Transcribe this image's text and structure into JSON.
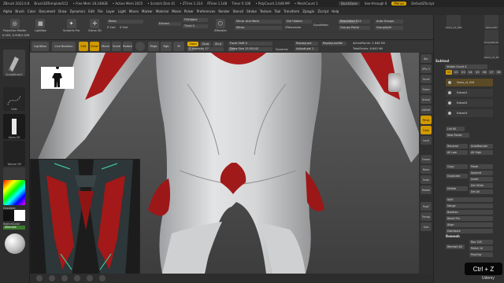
{
  "window": {
    "title_items": [
      "ZBrush 2022.0.8",
      "Brush3DTemplate512",
      "• Free Mem 18.248GB",
      "• Active Mem 2025",
      "• Scratch Disk 41",
      "• ZTime 1.314",
      "RTime 1.148",
      "Timer 0.106",
      "• PolyCount 2.648 MP",
      "• MeshCount 1"
    ],
    "quicksave": "QuickSave",
    "see_through": "See-through 0",
    "menus_label": "Menus",
    "default_script": "DefaultZScript"
  },
  "menubar": [
    "Alpha",
    "Brush",
    "Color",
    "Document",
    "Draw",
    "Dynamics",
    "Edit",
    "File",
    "Layer",
    "Light",
    "Macro",
    "Marker",
    "Material",
    "Movie",
    "Picker",
    "Preferences",
    "Render",
    "Stencil",
    "Stroke",
    "Texture",
    "Tool",
    "Transform",
    "Zplugin",
    "Zscript",
    "Help"
  ],
  "toolbar": {
    "coords": "0.003,-0.906,0.028",
    "buttons": [
      "Projection Master",
      "LightBox",
      "Sculptris Pro",
      "Gizmo 3D",
      "ZRemesher"
    ],
    "relax": "Relax",
    "extract": "Extract",
    "e_smt": "E Smt",
    "s_smt": "S Smt",
    "fill_object": "FillObject",
    "thick": "Thick 0",
    "zmodeler": "ZModeler",
    "mirror_weld": "Mirror And Weld",
    "del_hidden": "Del Hidden",
    "mirror": "Mirror",
    "zremesher": "ZRemesher",
    "dynamesh": "DynaMesh",
    "resolution": "Resolution 512",
    "auto_groups": "Auto Groups",
    "groups_polish": "Groups Polish",
    "group_split": "GroupSplit"
  },
  "toolbar2": {
    "lightbox": "LightBox",
    "live_boolean": "Live Boolean",
    "edit": "Edit",
    "draw": "Draw",
    "move": "Move",
    "scale": "Scale",
    "rotate": "Rotate",
    "mrgb": "Mrgb",
    "rgb": "Rgb",
    "m": "M",
    "zadd": "Zadd",
    "zsub": "Zsub",
    "zcut": "Zcut",
    "rgb_intensity": "Rgb Intensity",
    "z_intensity": "Z Intensity 17",
    "focal_shift": "Focal Shift 0",
    "draw_size": "Draw Size 15.55142",
    "dynamic": "Dynamic",
    "replay_last": "ReplayLast",
    "replay_last_rel": "ReplayLastRel",
    "adjust_last": "AdjustLast 1",
    "active_points": "ActivePoints: 2.648 Mil",
    "total_points": "TotalPoints: 8.645 Mil"
  },
  "left_shelf": {
    "brush": "SculptBrush3",
    "stroke": "Dots",
    "alpha": "Alpha Off",
    "texture": "Texture Off",
    "material": "SketchMaterial",
    "gradient": "Gradient",
    "switch_color": "SwitchColor",
    "alternate": "Alternate"
  },
  "right_panel": {
    "tool_thumbs": [
      "Sama_v2_008",
      "Sphere3D",
      "SimpleBrush",
      "Sama_v2_00"
    ],
    "subtool_title": "Subtool",
    "visible_count": "Visible Count 4",
    "slots": [
      "V1",
      "V2",
      "V3",
      "V4",
      "V5",
      "V6",
      "V7",
      "V8"
    ],
    "subtools": [
      "Sama_v2_008",
      "Extract1",
      "Extract2",
      "Extract3"
    ],
    "list_all": "List All",
    "new_folder": "New Folder",
    "rename": "Rename",
    "auto_reorder": "AutoReorder",
    "all_low": "All Low",
    "all_high": "All High",
    "copy": "Copy",
    "paste": "Paste",
    "duplicate": "Duplicate",
    "append": "Append",
    "insert": "Insert",
    "delete": "Delete",
    "del_other": "Del Other",
    "del_all": "Del All",
    "split": "Split",
    "merge": "Merge",
    "boolean": "Boolean",
    "bevel_pro": "Bevel Pro",
    "align": "Align",
    "distribute": "Distribute",
    "remesh_title": "Remesh",
    "remesh_all": "Remesh All",
    "res": "Res 128",
    "polish": "Polish 10",
    "polygroup": "PolyGrp"
  },
  "nav": [
    "Bpr",
    "SPix 3",
    "Scroll",
    "Zoom",
    "Actual",
    "AAHalf",
    "Persp",
    "Floor",
    "Local",
    "Frame",
    "Move",
    "Scale",
    "Rotate",
    "PolyF",
    "Transp",
    "Solo"
  ],
  "overlay": {
    "shortcut": "Ctrl + Z",
    "watermark": "Udemy"
  },
  "colors": {
    "accent": "#d19a00",
    "suit": "#d9dadb",
    "suit_red": "#a01a1a"
  }
}
